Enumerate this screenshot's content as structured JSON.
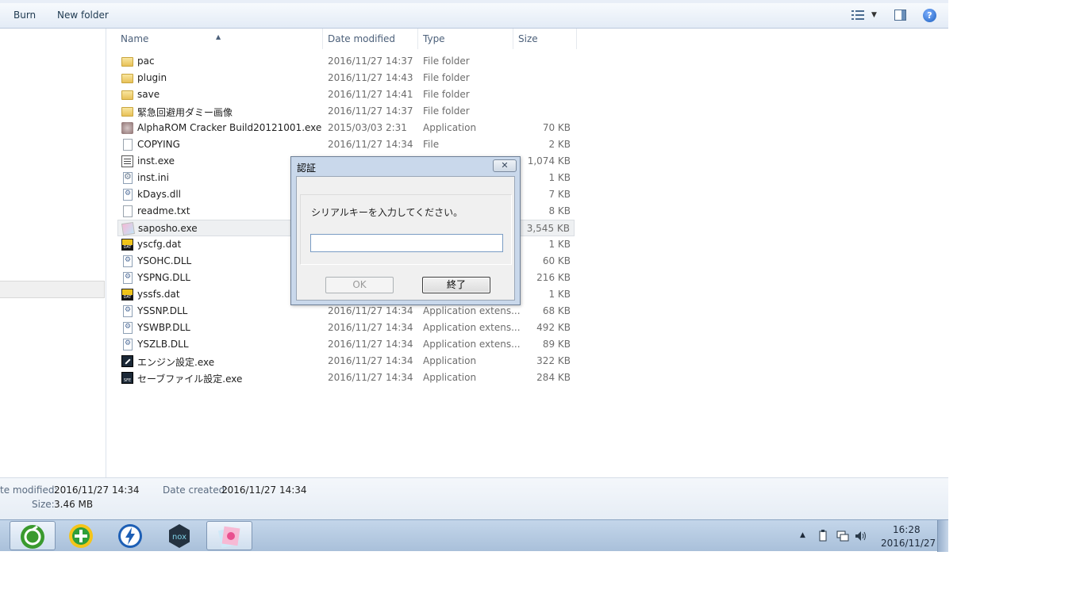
{
  "toolbar": {
    "burn": "Burn",
    "new_folder": "New folder"
  },
  "columns": {
    "name": "Name",
    "date_modified": "Date modified",
    "type": "Type",
    "size": "Size"
  },
  "files": [
    {
      "name": "pac",
      "date": "2016/11/27 14:37",
      "type": "File folder",
      "size": "",
      "icon": "folder-icon"
    },
    {
      "name": "plugin",
      "date": "2016/11/27 14:43",
      "type": "File folder",
      "size": "",
      "icon": "folder-icon"
    },
    {
      "name": "save",
      "date": "2016/11/27 14:41",
      "type": "File folder",
      "size": "",
      "icon": "folder-icon"
    },
    {
      "name": "緊急回避用ダミー画像",
      "date": "2016/11/27 14:37",
      "type": "File folder",
      "size": "",
      "icon": "folder-icon"
    },
    {
      "name": "AlphaROM Cracker Build20121001.exe",
      "date": "2015/03/03 2:31",
      "type": "Application",
      "size": "70 KB",
      "icon": "app-icon"
    },
    {
      "name": "COPYING",
      "date": "2016/11/27 14:34",
      "type": "File",
      "size": "2 KB",
      "icon": "file-icon"
    },
    {
      "name": "inst.exe",
      "date": "",
      "type": "",
      "size": "1,074 KB",
      "icon": "app-icon"
    },
    {
      "name": "inst.ini",
      "date": "",
      "type": "",
      "size": "1 KB",
      "icon": "ini-icon"
    },
    {
      "name": "kDays.dll",
      "date": "",
      "type": "",
      "size": "7 KB",
      "icon": "dll-icon"
    },
    {
      "name": "readme.txt",
      "date": "",
      "type": "",
      "size": "8 KB",
      "icon": "text-file-icon"
    },
    {
      "name": "saposho.exe",
      "date": "",
      "type": "",
      "size": "3,545 KB",
      "icon": "app-icon"
    },
    {
      "name": "yscfg.dat",
      "date": "",
      "type": "",
      "size": "1 KB",
      "icon": "dat-icon"
    },
    {
      "name": "YSOHC.DLL",
      "date": "",
      "type": "",
      "size": "60 KB",
      "icon": "dll-icon"
    },
    {
      "name": "YSPNG.DLL",
      "date": "",
      "type": "",
      "size": "216 KB",
      "icon": "dll-icon"
    },
    {
      "name": "yssfs.dat",
      "date": "",
      "type": "",
      "size": "1 KB",
      "icon": "dat-icon"
    },
    {
      "name": "YSSNP.DLL",
      "date": "2016/11/27 14:34",
      "type": "Application extens...",
      "size": "68 KB",
      "icon": "dll-icon"
    },
    {
      "name": "YSWBP.DLL",
      "date": "2016/11/27 14:34",
      "type": "Application extens...",
      "size": "492 KB",
      "icon": "dll-icon"
    },
    {
      "name": "YSZLB.DLL",
      "date": "2016/11/27 14:34",
      "type": "Application extens...",
      "size": "89 KB",
      "icon": "dll-icon"
    },
    {
      "name": "エンジン設定.exe",
      "date": "2016/11/27 14:34",
      "type": "Application",
      "size": "322 KB",
      "icon": "app-icon"
    },
    {
      "name": "セーブファイル設定.exe",
      "date": "2016/11/27 14:34",
      "type": "Application",
      "size": "284 KB",
      "icon": "app-icon"
    }
  ],
  "details": {
    "date_modified_label": "te modified:",
    "date_modified_value": "2016/11/27 14:34",
    "date_created_label": "Date created:",
    "date_created_value": "2016/11/27 14:34",
    "size_label": "Size:",
    "size_value": "3.46 MB"
  },
  "dialog": {
    "title": "認証",
    "close_glyph": "✕",
    "message": "シリアルキーを入力してください。",
    "input_value": "",
    "ok_label": "OK",
    "exit_label": "終了"
  },
  "taskbar": {
    "apps": [
      "app-green-icon",
      "app-plus-icon",
      "app-lightning-icon",
      "nox-icon",
      "saposho-icon"
    ],
    "nox_label": "nox",
    "clock_time": "16:28",
    "clock_date": "2016/11/27"
  },
  "help_glyph": "?",
  "tray_up_glyph": "▲",
  "view_caret_glyph": "▼",
  "sort_glyph": "▲"
}
